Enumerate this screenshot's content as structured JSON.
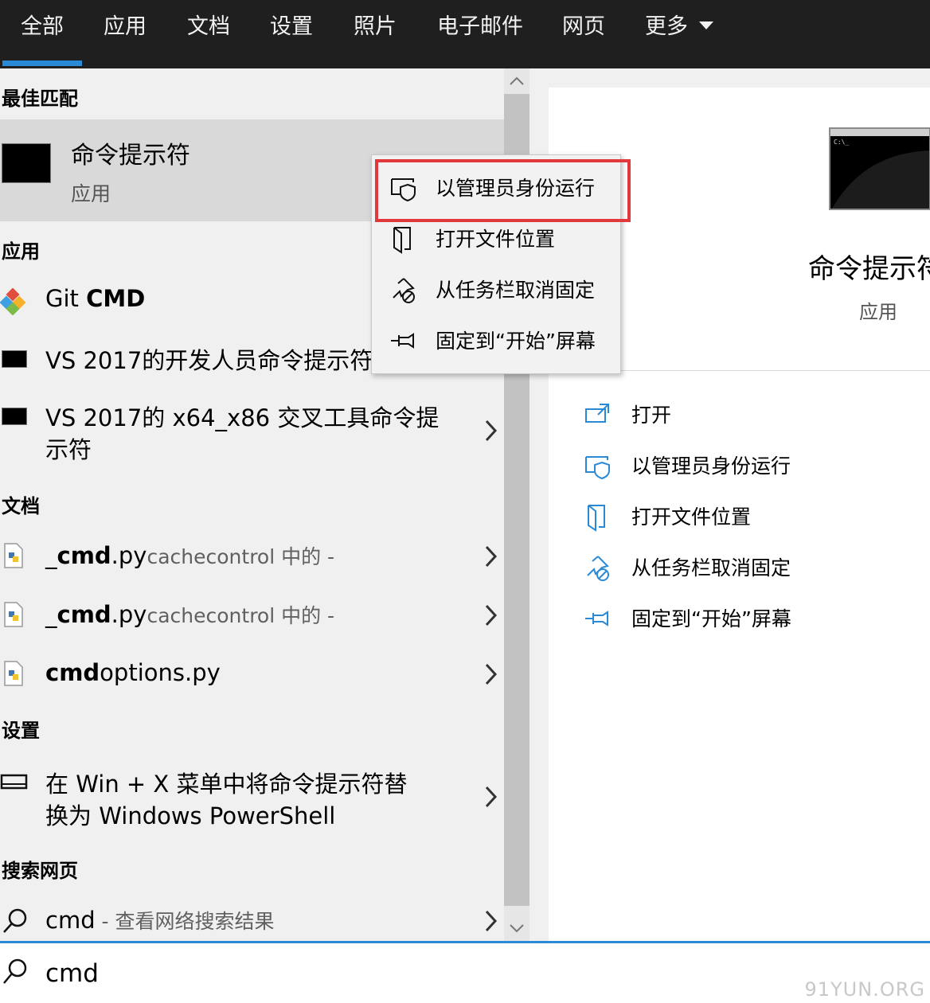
{
  "tabs": [
    {
      "label": "全部"
    },
    {
      "label": "应用"
    },
    {
      "label": "文档"
    },
    {
      "label": "设置"
    },
    {
      "label": "照片"
    },
    {
      "label": "电子邮件"
    },
    {
      "label": "网页"
    },
    {
      "label": "更多"
    }
  ],
  "sections": {
    "best_match": "最佳匹配",
    "apps": "应用",
    "documents": "文档",
    "settings": "设置",
    "web": "搜索网页"
  },
  "best_match": {
    "title": "命令提示符",
    "subtitle": "应用"
  },
  "apps": [
    {
      "label_normal": "Git ",
      "label_bold": "CMD"
    },
    {
      "label": "VS 2017的开发人员命令提示符"
    },
    {
      "line1": "VS 2017的 x64_x86 交叉工具命令提",
      "line2": "示符"
    }
  ],
  "documents": [
    {
      "prefix": "_",
      "bold": "cmd",
      "suffix": ".py",
      "location": "cachecontrol 中的 -"
    },
    {
      "prefix": "_",
      "bold": "cmd",
      "suffix": ".py",
      "location": "cachecontrol 中的 -"
    },
    {
      "prefix": "",
      "bold": "cmd",
      "suffix": "options.py",
      "location": ""
    }
  ],
  "settings_item": {
    "line1": "在 Win + X 菜单中将命令提示符替",
    "line2": "换为 Windows PowerShell"
  },
  "web_item": {
    "query": "cmd",
    "hint": " - 查看网络搜索结果"
  },
  "context_menu": [
    {
      "label": "以管理员身份运行",
      "icon": "shield-icon"
    },
    {
      "label": "打开文件位置",
      "icon": "folder-location-icon"
    },
    {
      "label": "从任务栏取消固定",
      "icon": "unpin-icon"
    },
    {
      "label": "固定到“开始”屏幕",
      "icon": "pin-icon"
    }
  ],
  "detail": {
    "title": "命令提示符",
    "subtitle": "应用",
    "actions": [
      {
        "label": "打开",
        "icon": "open-icon"
      },
      {
        "label": "以管理员身份运行",
        "icon": "shield-icon"
      },
      {
        "label": "打开文件位置",
        "icon": "folder-location-icon"
      },
      {
        "label": "从任务栏取消固定",
        "icon": "unpin-icon"
      },
      {
        "label": "固定到“开始”屏幕",
        "icon": "pin-icon"
      }
    ]
  },
  "search": {
    "value": "cmd"
  },
  "watermark": "91YUN.ORG",
  "colors": {
    "accent": "#2b8ad6",
    "highlight": "#e0383b",
    "topbar": "#1f1f1f"
  }
}
